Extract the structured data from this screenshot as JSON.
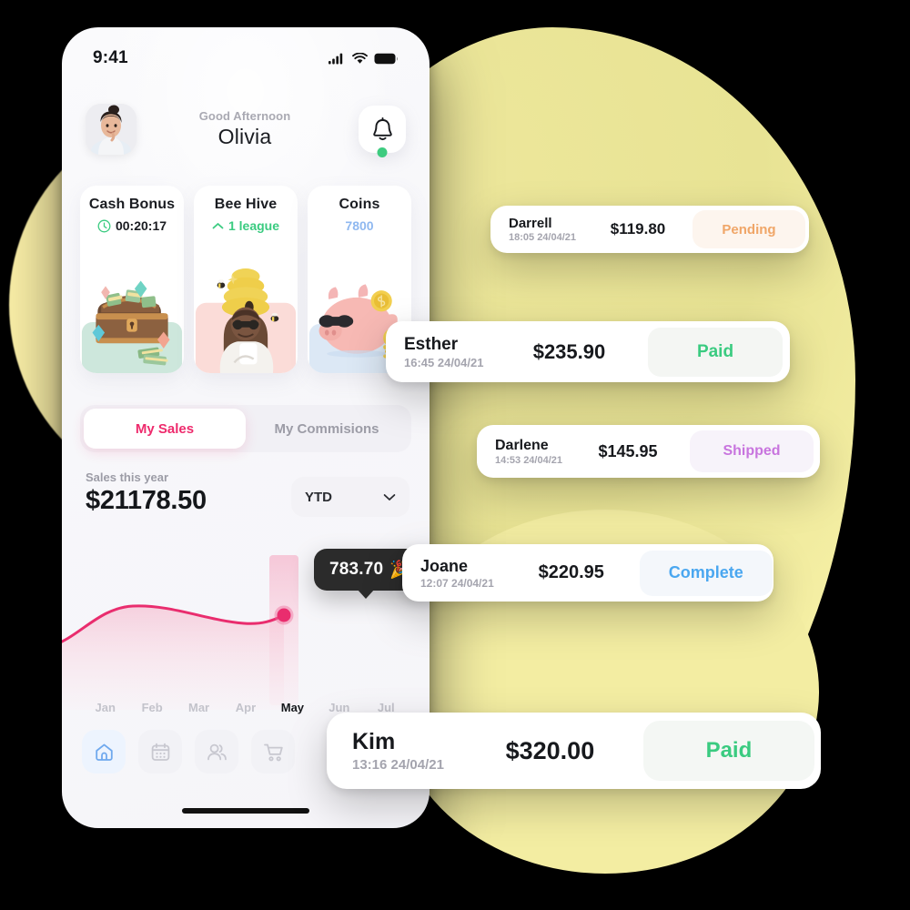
{
  "phone": {
    "status_bar": {
      "time": "9:41",
      "signal_icon": "cellular-signal-icon",
      "wifi_icon": "wifi-icon",
      "battery_icon": "battery-icon"
    },
    "header": {
      "greeting": "Good Afternoon",
      "user_name": "Olivia",
      "avatar_icon": "user-avatar",
      "bell_icon": "bell-icon",
      "notification_dot_color": "#3DCB7F"
    },
    "stat_cards": [
      {
        "title": "Cash Bonus",
        "value": "00:20:17",
        "icon": "clock-icon",
        "value_color": "#1A1C21",
        "art": "treasure-chest-illustration"
      },
      {
        "title": "Bee Hive",
        "value": "1 league",
        "icon": "chevron-up-icon",
        "value_color": "#3ACB80",
        "art": "beehive-woman-illustration"
      },
      {
        "title": "Coins",
        "value": "7800",
        "icon": "none",
        "value_color": "#8FB8F0",
        "art": "piggy-bank-illustration"
      }
    ],
    "tabs": [
      {
        "label": "My Sales",
        "active": true
      },
      {
        "label": "My Commisions",
        "active": false
      }
    ],
    "sales": {
      "label": "Sales this year",
      "amount": "$21178.50",
      "range_selector": "YTD",
      "chevron_icon": "chevron-down-icon"
    },
    "chart_data": {
      "type": "line",
      "title": "Sales this year",
      "categories": [
        "Jan",
        "Feb",
        "Mar",
        "Apr",
        "May",
        "Jun",
        "Jul"
      ],
      "values": [
        310,
        770,
        750,
        735,
        783.7,
        null,
        null
      ],
      "highlight_index": 4,
      "highlight_label": "783.70",
      "highlight_emoji": "🎉",
      "line_color": "#E92D6E",
      "fill_color": "#FAD9E4",
      "xlabel": "",
      "ylabel": "",
      "grid": false,
      "legend": "none"
    },
    "bottom_nav": [
      {
        "icon": "home-icon",
        "active": true
      },
      {
        "icon": "calendar-icon",
        "active": false
      },
      {
        "icon": "people-icon",
        "active": false
      },
      {
        "icon": "cart-icon",
        "active": false
      }
    ]
  },
  "transactions": [
    {
      "name": "Darrell",
      "time": "18:05 24/04/21",
      "amount": "$119.80",
      "status": "Pending"
    },
    {
      "name": "Esther",
      "time": "16:45 24/04/21",
      "amount": "$235.90",
      "status": "Paid"
    },
    {
      "name": "Darlene",
      "time": "14:53 24/04/21",
      "amount": "$145.95",
      "status": "Shipped"
    },
    {
      "name": "Joane",
      "time": "12:07 24/04/21",
      "amount": "$220.95",
      "status": "Complete"
    },
    {
      "name": "Kim",
      "time": "13:16 24/04/21",
      "amount": "$320.00",
      "status": "Paid"
    }
  ],
  "theme": {
    "background": "#000000",
    "blob_yellow": "#EFE99D",
    "blob_yellow_light": "#FBF0A8",
    "accent_pink": "#EE2A6C",
    "status_paid": "#3ACB80",
    "status_pending": "#F0A668",
    "status_shipped": "#C874DE",
    "status_complete": "#4AA7F0"
  }
}
